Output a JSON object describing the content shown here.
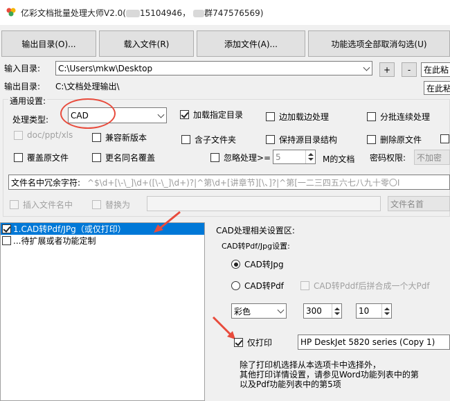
{
  "window": {
    "title_prefix": "亿彩文档批量处理大师V2.0(",
    "title_mid": "15104946，",
    "title_suffix": "群747576569)"
  },
  "toolbar": {
    "output_dir": "输出目录(O)...",
    "load_file": "载入文件(R)",
    "add_file": "添加文件(A)...",
    "uncheck_all": "功能选项全部取消勾选(U)"
  },
  "paths": {
    "input_label": "输入目录:",
    "input_value": "C:\\Users\\mkw\\Desktop",
    "output_label": "输出目录:",
    "output_value": "C:\\文档处理输出\\",
    "plus": "+",
    "minus": "-",
    "side1": "在此粘",
    "side2": "在此粘"
  },
  "general": {
    "group_label": "通用设置:",
    "type_label": "处理类型:",
    "type_value": "CAD",
    "load_dir": "加载指定目录",
    "load_while": "边加载边处理",
    "batch_cont": "分批连续处理",
    "doc_types": "doc/ppt/xls",
    "compat_new": "兼容新版本",
    "include_sub": "含子文件夹",
    "keep_struct": "保持源目录结构",
    "delete_src": "删除原文件",
    "overwrite": "覆盖原文件",
    "rename_overwrite": "更名同名覆盖",
    "ignore_gt": "忽略处理>=",
    "ignore_value": "5",
    "mb_doc": "M的文档",
    "pwd_label": "密码权限:",
    "pwd_value": "不加密",
    "redundant_label": "文件名中冗余字符:",
    "redundant_value": "^$\\d+[\\-\\_]\\d+([\\-\\_]\\d+)?|^第\\d+[讲章节][\\、]?|^第[一二三四五六七八九十零〇I",
    "insert_name": "插入文件名中",
    "replace_with": "替换为",
    "name_head": "文件名首"
  },
  "tasks": {
    "items": [
      {
        "label": "1.CAD转Pdf/JPg（或仅打印）",
        "checked": true
      },
      {
        "label": "...待扩展或者功能定制",
        "checked": false
      }
    ]
  },
  "cad": {
    "area_label": "CAD处理相关设置区:",
    "sub_label": "CAD转Pdf/Jpg设置:",
    "to_jpg": "CAD转Jpg",
    "to_pdf": "CAD转Pdf",
    "merge_pdf": "CAD转Pddf后拼合成一个大Pdf",
    "color_value": "彩色",
    "dpi1": "300",
    "dpi2": "10",
    "print_only": "仅打印",
    "printer": "HP DeskJet 5820 series (Copy 1)",
    "note1": "除了打印机选择从本选项卡中选择外，",
    "note2": "其他打印详情设置，请参见Word功能列表中的第",
    "note3": "以及Pdf功能列表中的第5项"
  },
  "colors": {
    "accent": "#0078d7",
    "annotation": "#e84b3c"
  }
}
